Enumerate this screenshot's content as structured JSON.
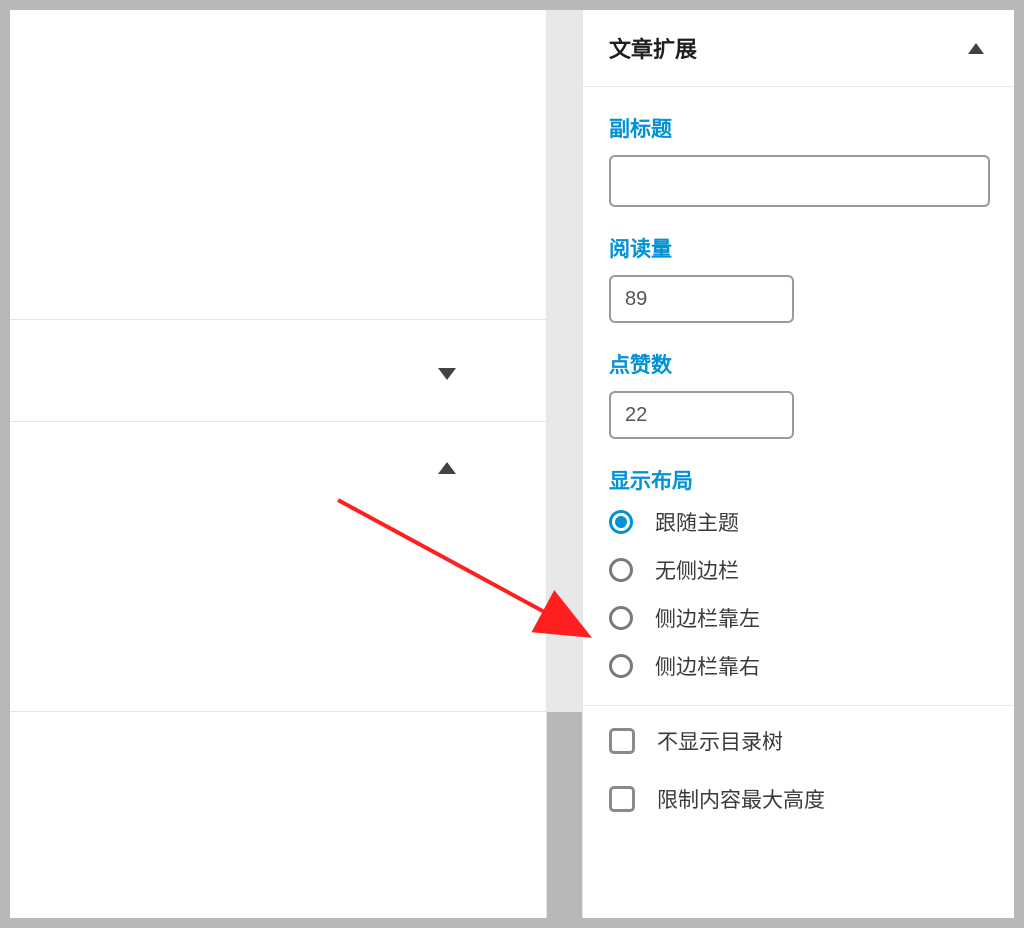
{
  "panel": {
    "title": "文章扩展",
    "subtitle_label": "副标题",
    "subtitle_value": "",
    "views_label": "阅读量",
    "views_value": "89",
    "likes_label": "点赞数",
    "likes_value": "22",
    "layout_label": "显示布局",
    "layout_options": [
      {
        "label": "跟随主题",
        "checked": true
      },
      {
        "label": "无侧边栏",
        "checked": false
      },
      {
        "label": "侧边栏靠左",
        "checked": false
      },
      {
        "label": "侧边栏靠右",
        "checked": false
      }
    ],
    "hide_toc_label": "不显示目录树",
    "limit_height_label": "限制内容最大高度"
  }
}
